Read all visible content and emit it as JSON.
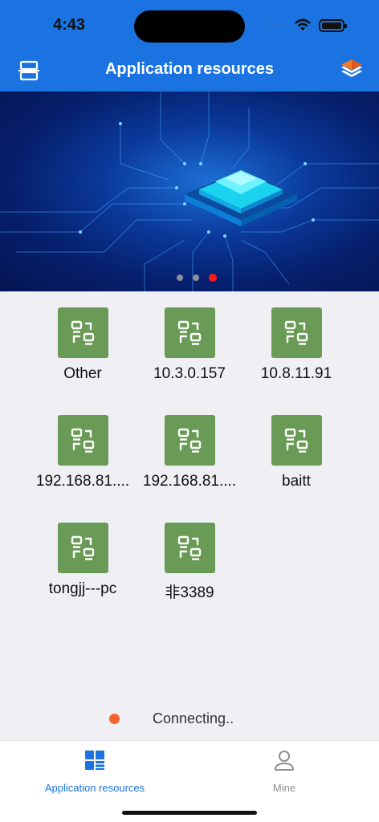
{
  "status_bar": {
    "time": "4:43"
  },
  "nav": {
    "title": "Application resources"
  },
  "banner": {
    "page_count": 3,
    "active_page": 3
  },
  "resources": [
    {
      "label": "Other"
    },
    {
      "label": "10.3.0.157"
    },
    {
      "label": "10.8.11.91"
    },
    {
      "label": "192.168.81...."
    },
    {
      "label": "192.168.81...."
    },
    {
      "label": "baitt"
    },
    {
      "label": "tongjj---pc"
    },
    {
      "label": "非3389"
    }
  ],
  "connection": {
    "status_text": "Connecting..",
    "dot_color": "#f5622a"
  },
  "tabs": [
    {
      "label": "Application resources",
      "active": true
    },
    {
      "label": "Mine",
      "active": false
    }
  ],
  "colors": {
    "primary": "#1a73e0",
    "resource_tile": "#6a9b56"
  }
}
